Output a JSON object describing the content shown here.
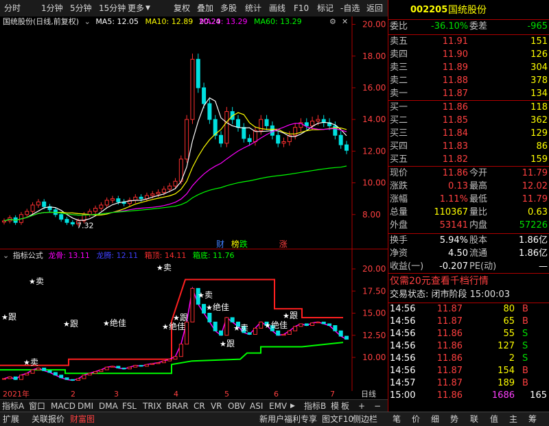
{
  "toolbar": {
    "items": [
      "分时",
      "1分钟",
      "5分钟",
      "15分钟",
      "更多",
      "复权",
      "叠加",
      "多股",
      "统计",
      "画线",
      "F10",
      "标记",
      "-自选",
      "返回"
    ],
    "more_icon": "triangle-down-icon"
  },
  "main_chart": {
    "title": "国统股份(日线,前复权)",
    "ma": [
      {
        "label": "MA5: 12.05",
        "color": "#ffffff"
      },
      {
        "label": "MA10: 12.89",
        "color": "#ffff00"
      },
      {
        "label": "MA20: 13.29",
        "color": "#ff00ff"
      },
      {
        "label": "MA60: 13.29",
        "color": "#00ff00"
      }
    ],
    "y_ticks": [
      "20.00",
      "18.00",
      "16.00",
      "14.00",
      "12.00",
      "10.00",
      "8.00"
    ],
    "high_label": "20.24",
    "low_label": "7.32",
    "marks": [
      {
        "text": "财",
        "color": "#4080ff"
      },
      {
        "text": "榜",
        "color": "#ffff00"
      },
      {
        "text": "跌",
        "color": "#00ff00"
      },
      {
        "text": "涨",
        "color": "#ff4040"
      }
    ],
    "chart_data": {
      "type": "candlestick",
      "ylim": [
        7,
        20.5
      ],
      "high": 20.24,
      "low": 7.32,
      "close_series": [
        7.6,
        7.8,
        7.5,
        8.0,
        8.2,
        8.6,
        8.8,
        8.5,
        8.3,
        8.0,
        7.7,
        7.5,
        7.4,
        7.6,
        8.0,
        8.2,
        8.4,
        8.6,
        8.9,
        9.0,
        8.8,
        8.7,
        8.9,
        9.1,
        9.0,
        9.2,
        9.3,
        9.4,
        9.6,
        9.8,
        10.1,
        11.5,
        14.0,
        17.8,
        16.0,
        15.0,
        14.0,
        13.0,
        12.5,
        14.5,
        14.0,
        13.5,
        12.8,
        12.6,
        13.3,
        14.0,
        13.6,
        13.0,
        12.5,
        12.6,
        13.0,
        13.5,
        13.8,
        13.6,
        13.9,
        14.0,
        13.8,
        13.6,
        13.0,
        12.4,
        12.05
      ]
    }
  },
  "indicator": {
    "title": "指标公式",
    "params": [
      {
        "label": "龙骨: 13.11",
        "color": "#ff00ff"
      },
      {
        "label": "龙腾: 12.11",
        "color": "#4040ff"
      },
      {
        "label": "箱顶: 14.11",
        "color": "#ff3030"
      },
      {
        "label": "箱底: 11.76",
        "color": "#00ff00"
      }
    ],
    "y_ticks": [
      "20.00",
      "17.50",
      "15.00",
      "12.50",
      "10.00"
    ],
    "signal_labels": [
      "卖",
      "卖",
      "卖",
      "卖",
      "卖",
      "跟",
      "跟",
      "跟",
      "跟",
      "绝佳",
      "绝佳",
      "绝佳",
      "绝佳",
      "跟"
    ],
    "x_labels": [
      "2021年",
      "2",
      "3",
      "4",
      "5",
      "6",
      "7"
    ],
    "axis_right": "日线"
  },
  "bottom_tabs": {
    "items": [
      "指标A",
      "窗口",
      "MACD",
      "DMI",
      "DMA",
      "FSL",
      "TRIX",
      "BRAR",
      "CR",
      "VR",
      "OBV",
      "ASI",
      "EMV"
    ],
    "right_items": [
      "指标B",
      "模",
      "板",
      "+",
      "−"
    ]
  },
  "status_bar": {
    "left": [
      "扩展",
      "关联报价",
      "财富图"
    ],
    "middle": [
      "新用户福利专享",
      "图文F10",
      "侧边栏"
    ],
    "right": [
      "笔",
      "价",
      "细",
      "势",
      "联",
      "值",
      "主",
      "筹"
    ]
  },
  "quote": {
    "code": "002205",
    "name": "国统股份",
    "weibi_label": "委比",
    "weibi": "-36.10%",
    "weicha_label": "委差",
    "weicha": "-965",
    "sell": [
      {
        "label": "卖五",
        "price": "11.91",
        "vol": "151"
      },
      {
        "label": "卖四",
        "price": "11.90",
        "vol": "126"
      },
      {
        "label": "卖三",
        "price": "11.89",
        "vol": "304"
      },
      {
        "label": "卖二",
        "price": "11.88",
        "vol": "378"
      },
      {
        "label": "卖一",
        "price": "11.87",
        "vol": "134"
      }
    ],
    "buy": [
      {
        "label": "买一",
        "price": "11.86",
        "vol": "118"
      },
      {
        "label": "买二",
        "price": "11.85",
        "vol": "362"
      },
      {
        "label": "买三",
        "price": "11.84",
        "vol": "129"
      },
      {
        "label": "买四",
        "price": "11.83",
        "vol": "86"
      },
      {
        "label": "买五",
        "price": "11.82",
        "vol": "159"
      }
    ],
    "stats": [
      {
        "l1": "现价",
        "v1": "11.86",
        "c1": "red",
        "l2": "今开",
        "v2": "11.79",
        "c2": "red"
      },
      {
        "l1": "涨跌",
        "v1": "0.13",
        "c1": "red",
        "l2": "最高",
        "v2": "12.02",
        "c2": "red"
      },
      {
        "l1": "涨幅",
        "v1": "1.11%",
        "c1": "red",
        "l2": "最低",
        "v2": "11.79",
        "c2": "red"
      },
      {
        "l1": "总量",
        "v1": "110367",
        "c1": "yellow",
        "l2": "量比",
        "v2": "0.63",
        "c2": "yellow"
      },
      {
        "l1": "外盘",
        "v1": "53141",
        "c1": "red",
        "l2": "内盘",
        "v2": "57226",
        "c2": "green"
      }
    ],
    "stats2": [
      {
        "l1": "换手",
        "v1": "5.94%",
        "l2": "股本",
        "v2": "1.86亿"
      },
      {
        "l1": "净资",
        "v1": "4.50",
        "l2": "流通",
        "v2": "1.86亿"
      },
      {
        "l1": "收益(一)",
        "v1": "-0.207",
        "l2": "PE(动)",
        "v2": "—"
      }
    ],
    "promo": "仅需20元查看千档行情",
    "trade_status": "交易状态: 闭市阶段 15:00:03",
    "ticks": [
      {
        "t": "14:56",
        "p": "11.87",
        "v": "80",
        "s": "B"
      },
      {
        "t": "14:56",
        "p": "11.87",
        "v": "65",
        "s": "B"
      },
      {
        "t": "14:56",
        "p": "11.86",
        "v": "55",
        "s": "S"
      },
      {
        "t": "14:56",
        "p": "11.86",
        "v": "127",
        "s": "S"
      },
      {
        "t": "14:56",
        "p": "11.86",
        "v": "2",
        "s": "S"
      },
      {
        "t": "14:56",
        "p": "11.87",
        "v": "154",
        "s": "B"
      },
      {
        "t": "14:57",
        "p": "11.87",
        "v": "189",
        "s": "B"
      },
      {
        "t": "15:00",
        "p": "11.86",
        "v": "1686",
        "s": "165"
      }
    ]
  }
}
